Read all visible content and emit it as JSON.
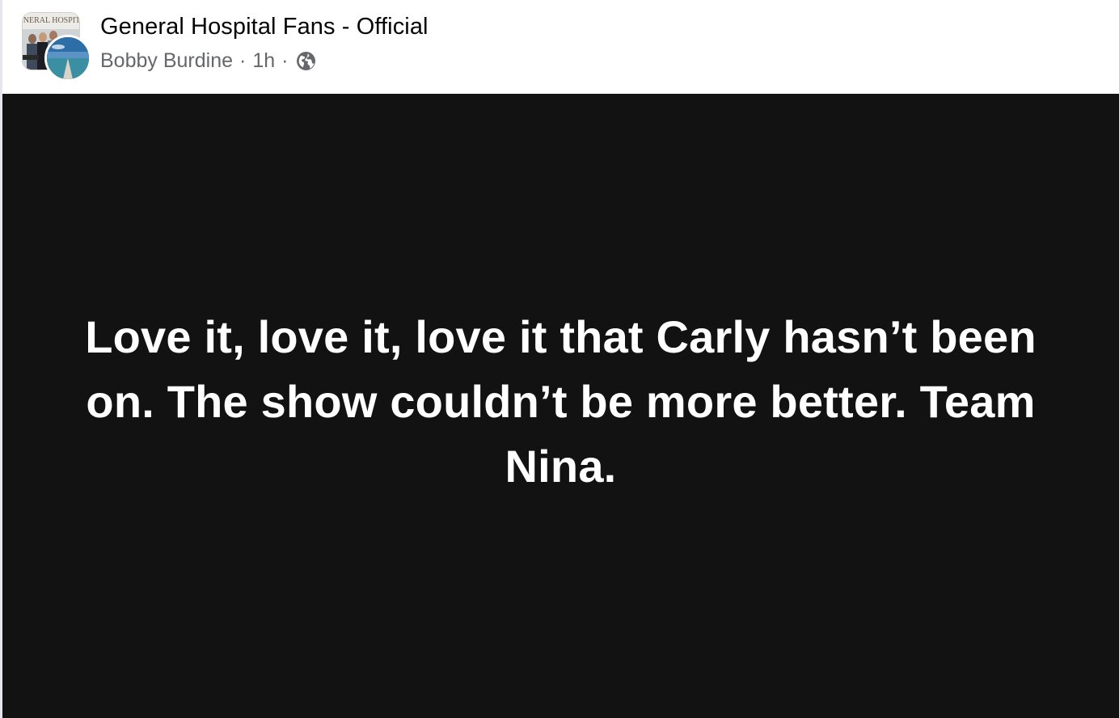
{
  "post": {
    "group_name": "General Hospital Fans - Official",
    "author": "Bobby Burdine",
    "separator": "·",
    "time": "1h",
    "privacy_icon": "globe-icon",
    "group_avatar_text": "NERAL HOSPIT",
    "body": "Love it, love it, love it that Carly hasn’t been on. The show couldn’t be more better. Team Nina.",
    "background_color": "#121212",
    "text_color": "#ffffff"
  }
}
